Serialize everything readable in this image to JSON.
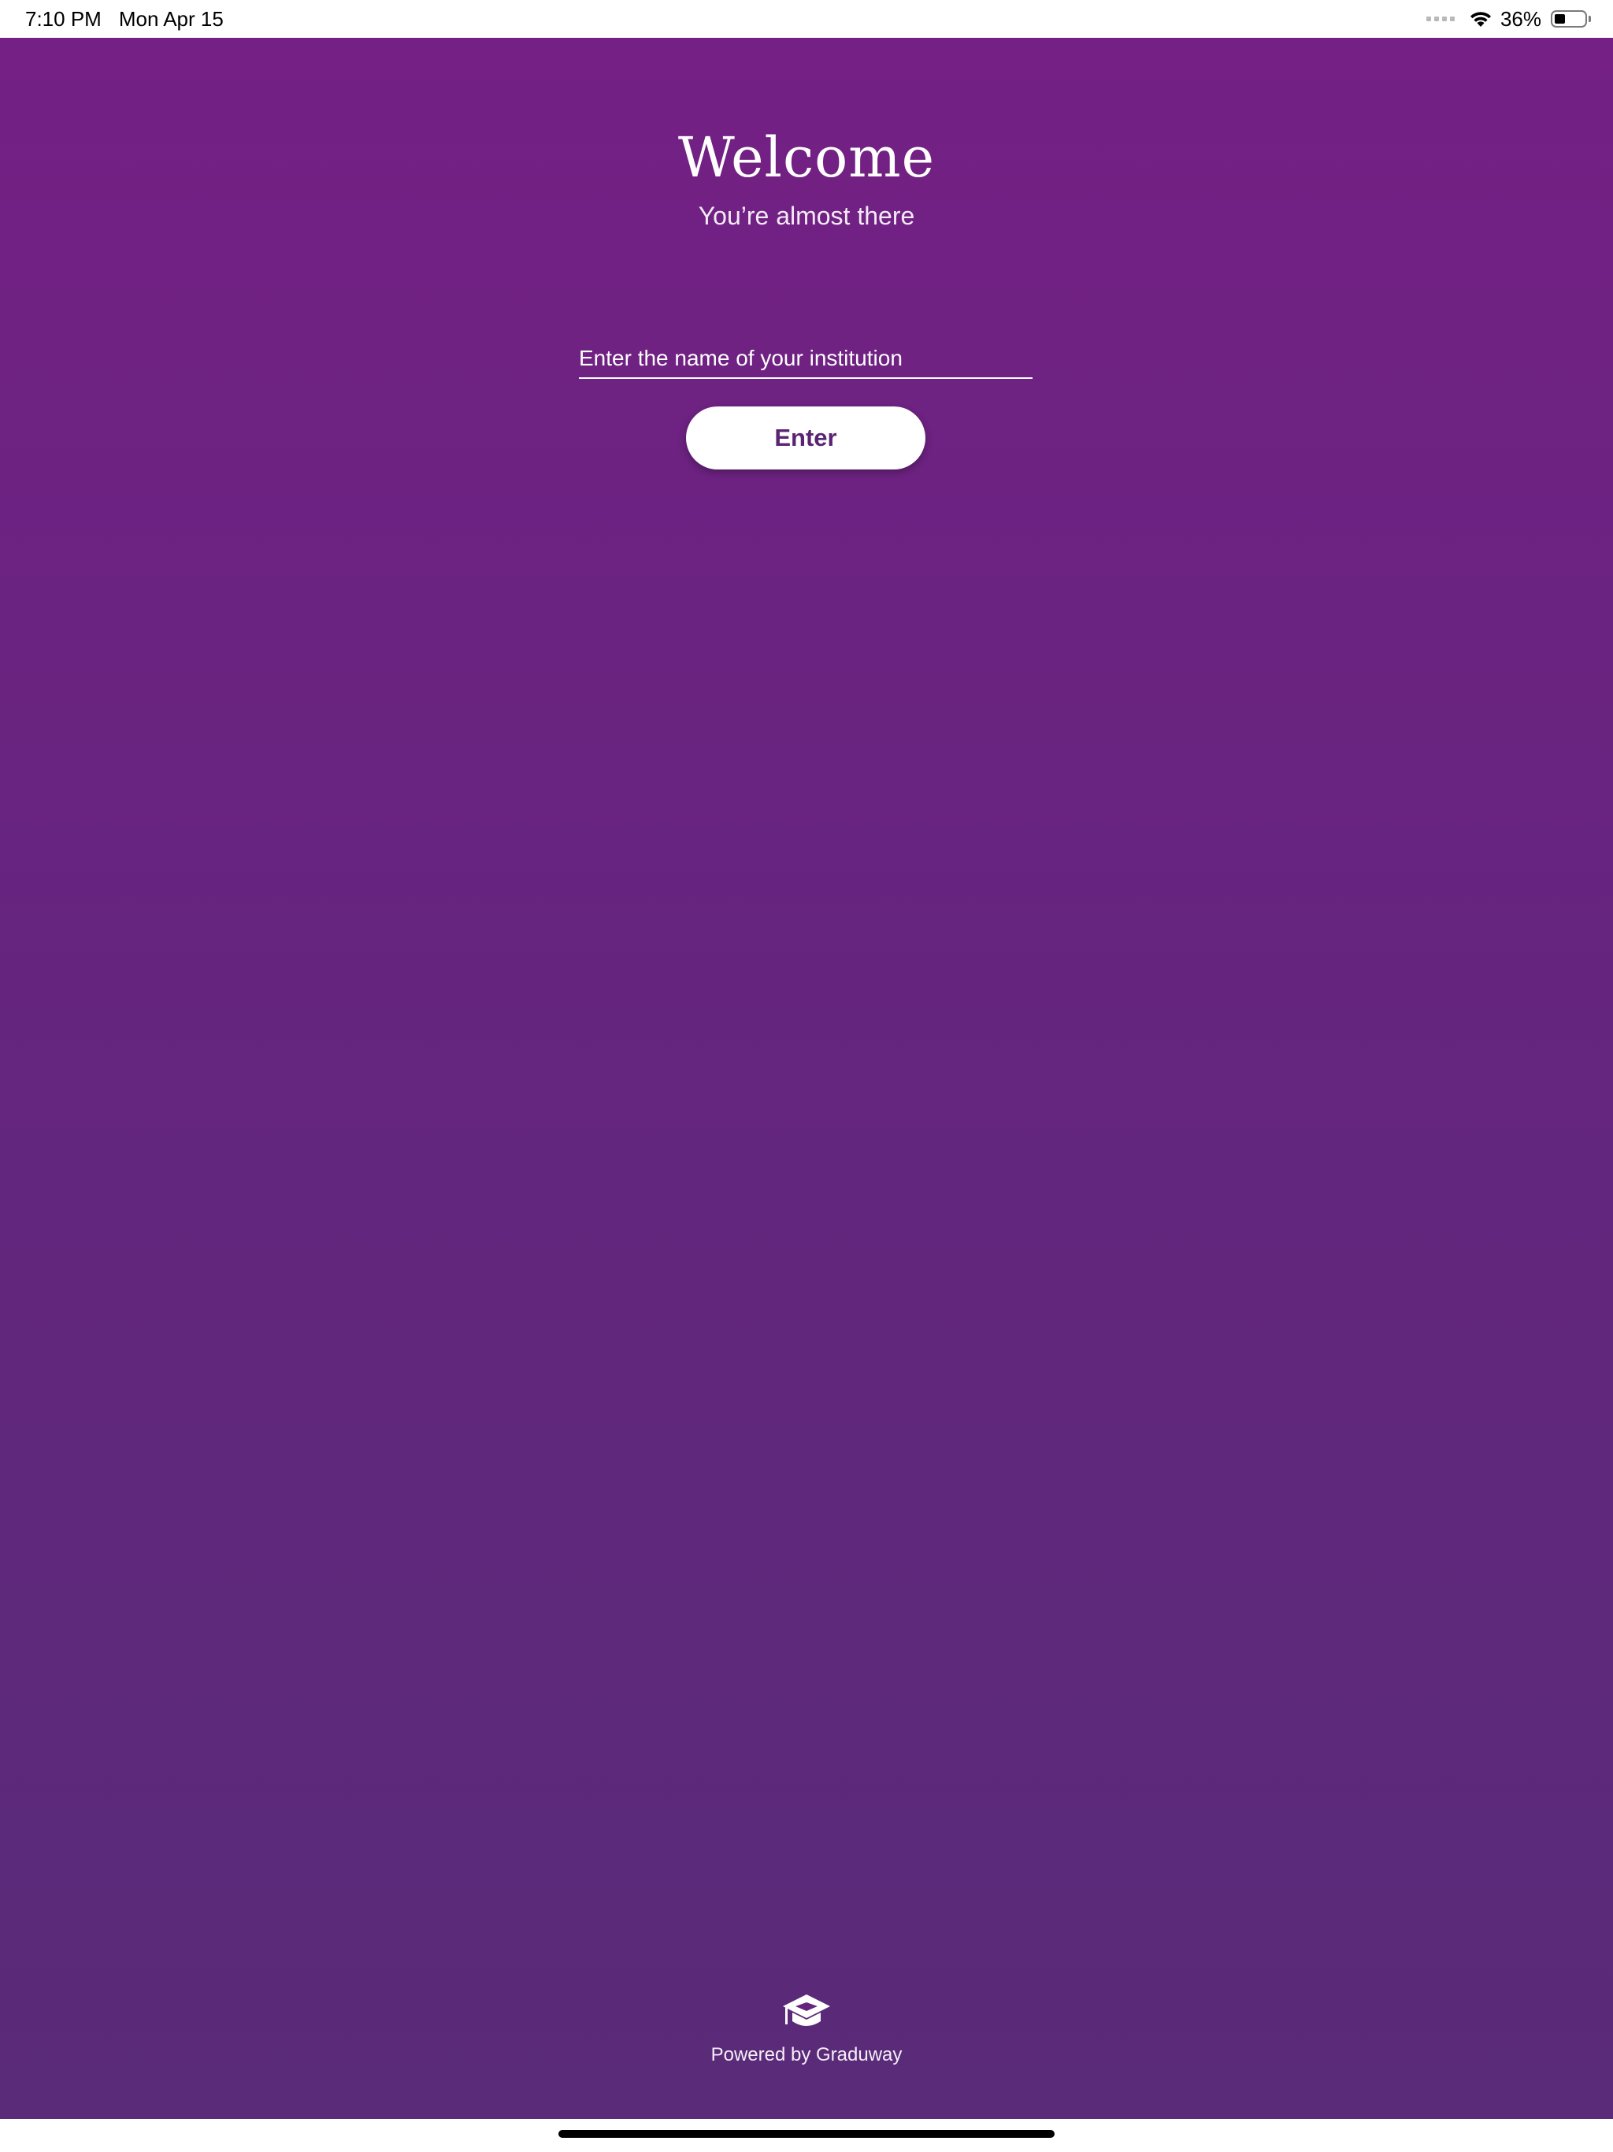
{
  "status_bar": {
    "time": "7:10 PM",
    "date": "Mon Apr 15",
    "battery_percent": "36%",
    "battery_level": 0.36,
    "icons": [
      "cellular-signal-icon",
      "wifi-icon",
      "battery-icon"
    ]
  },
  "welcome": {
    "title": "Welcome",
    "subtitle": "You’re almost there"
  },
  "institution_field": {
    "placeholder": "Enter the name of your institution",
    "value": ""
  },
  "enter_button": {
    "label": "Enter"
  },
  "footer": {
    "logo_icon": "graduation-cap-icon",
    "powered_by": "Powered by Graduway"
  },
  "colors": {
    "background_top": "#742084",
    "background_bottom": "#592b78",
    "button_text": "#5a2473",
    "text": "#ffffff"
  }
}
